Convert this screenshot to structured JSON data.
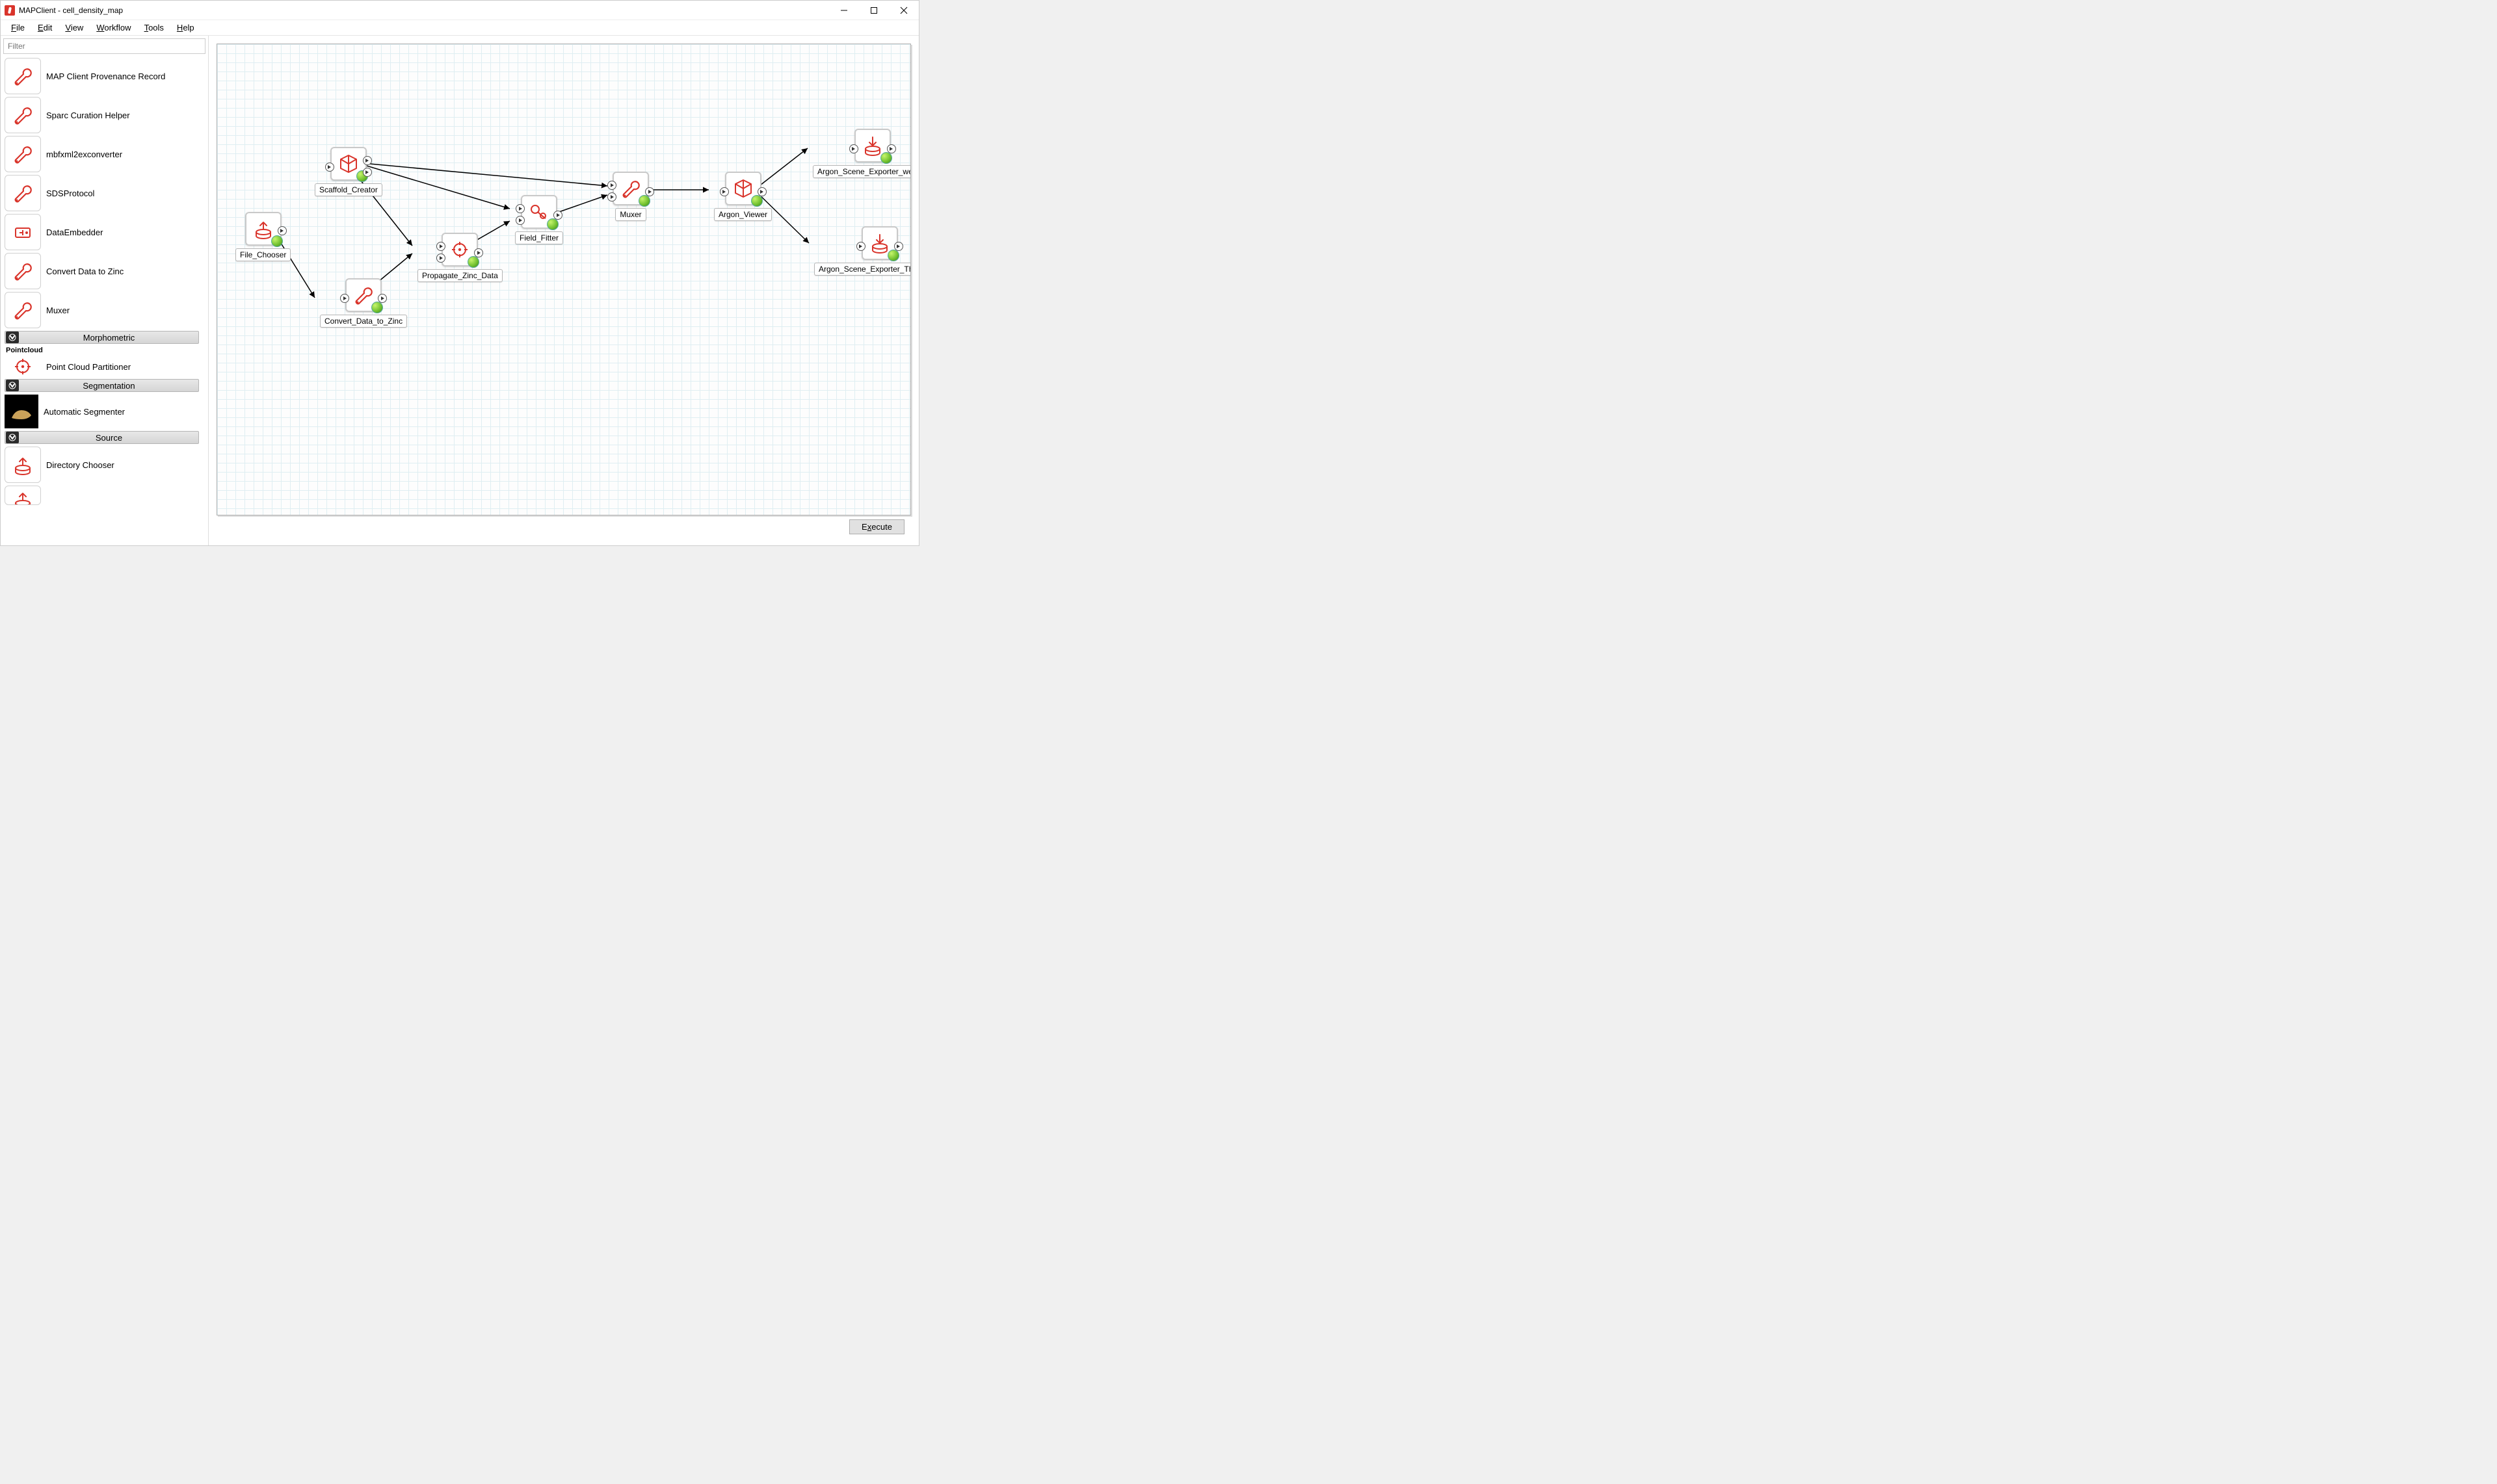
{
  "window": {
    "title": "MAPClient - cell_density_map"
  },
  "menu": {
    "file": "File",
    "edit": "Edit",
    "view": "View",
    "workflow": "Workflow",
    "tools": "Tools",
    "help": "Help"
  },
  "sidebar": {
    "filter_placeholder": "Filter",
    "tools": [
      {
        "label": "MAP Client Provenance Record",
        "icon": "wrench"
      },
      {
        "label": "Sparc Curation Helper",
        "icon": "wrench"
      },
      {
        "label": "mbfxml2exconverter",
        "icon": "wrench"
      },
      {
        "label": "SDSProtocol",
        "icon": "wrench"
      },
      {
        "label": "DataEmbedder",
        "icon": "embed"
      },
      {
        "label": "Convert Data to Zinc",
        "icon": "wrench"
      },
      {
        "label": "Muxer",
        "icon": "wrench"
      }
    ],
    "sections": {
      "morphometric": "Morphometric",
      "pointcloud_label": "Pointcloud",
      "pointcloud_tool": "Point Cloud Partitioner",
      "segmentation": "Segmentation",
      "segmentation_tool": "Automatic Segmenter",
      "source": "Source",
      "source_tool": "Directory Chooser"
    }
  },
  "nodes": {
    "scaffold_creator": "Scaffold_Creator",
    "file_chooser": "File_Chooser",
    "convert_data_to_zinc": "Convert_Data_to_Zinc",
    "propagate_zinc_data": "Propagate_Zinc_Data",
    "field_fitter": "Field_Fitter",
    "muxer": "Muxer",
    "argon_viewer": "Argon_Viewer",
    "argon_scene_exporter_webgl": "Argon_Scene_Exporter_webGL",
    "argon_scene_exporter_thumbnail": "Argon_Scene_Exporter_Thumbnail"
  },
  "footer": {
    "execute": "Execute"
  }
}
